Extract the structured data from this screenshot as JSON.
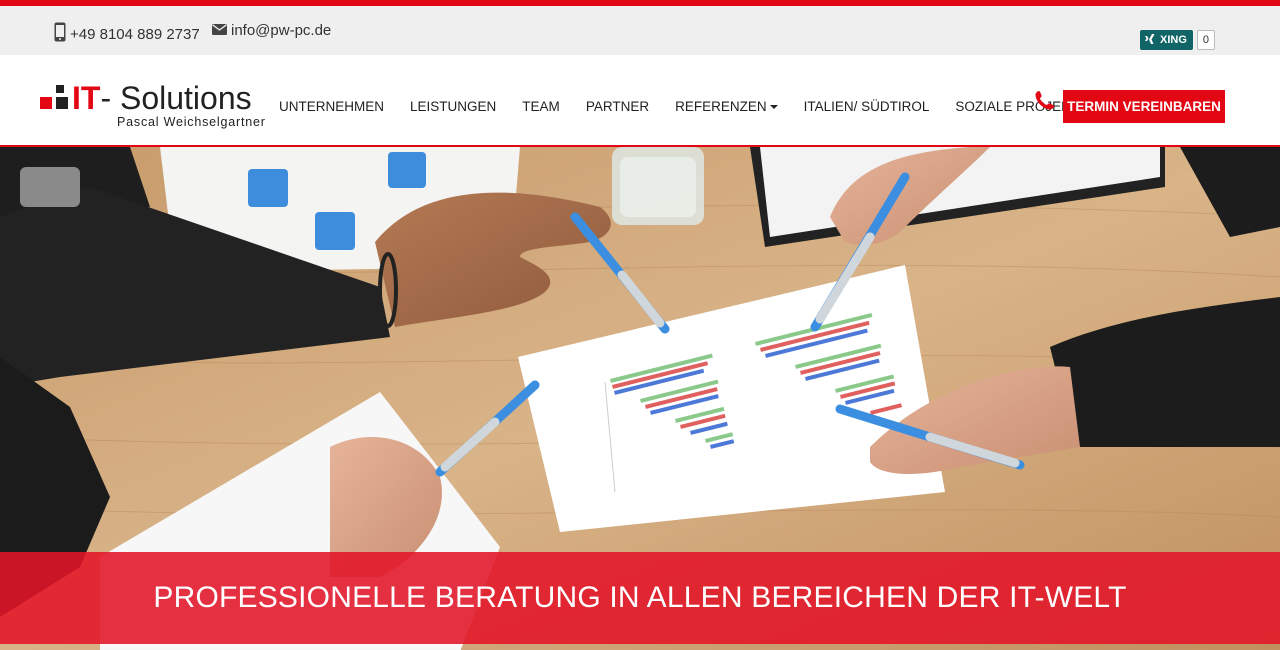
{
  "topbar": {
    "phone": "+49 8104 889 2737",
    "email": "info@pw-pc.de",
    "xing": {
      "label": "XING",
      "count": "0"
    }
  },
  "logo": {
    "brand": "IT",
    "brand_rest": "- Solutions",
    "subtitle": "Pascal Weichselgartner"
  },
  "nav": {
    "items": [
      {
        "label": "UNTERNEHMEN"
      },
      {
        "label": "LEISTUNGEN"
      },
      {
        "label": "TEAM"
      },
      {
        "label": "PARTNER"
      },
      {
        "label": "REFERENZEN",
        "dropdown": true
      },
      {
        "label": "ITALIEN/ SÜDTIROL"
      },
      {
        "label": "SOZIALE PROJEKTE"
      }
    ],
    "cta": "TERMIN VEREINBAREN"
  },
  "hero": {
    "headline": "PROFESSIONELLE BERATUNG IN ALLEN BEREICHEN DER IT-WELT"
  },
  "colors": {
    "accent": "#e30613",
    "xing": "#126567"
  }
}
